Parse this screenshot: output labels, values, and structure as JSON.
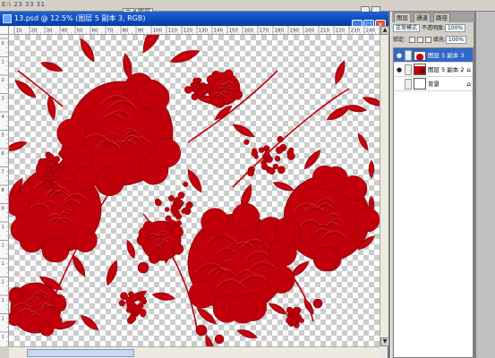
{
  "app": {
    "top_path": "E:\\ 23 33 31",
    "top_tabs": [
      "☰",
      "图层",
      "☰"
    ]
  },
  "document": {
    "title": "13.psd @ 12.5% (图层 5 副本 3, RGB)",
    "ruler_h_labels": [
      "10",
      "20",
      "30",
      "40",
      "50",
      "60",
      "70",
      "80",
      "90",
      "100",
      "110",
      "120",
      "130",
      "140",
      "150",
      "160",
      "170",
      "180",
      "190",
      "200",
      "210",
      "220",
      "230",
      "240"
    ],
    "ruler_v_labels": [
      "0",
      "10",
      "20",
      "30",
      "40",
      "50",
      "60",
      "70",
      "80",
      "90",
      "100",
      "110",
      "120",
      "130",
      "140",
      "150",
      "160"
    ],
    "artwork_colors": {
      "red": "#c1000b",
      "dark_red": "#7e0008",
      "highlight": "#e53a3a"
    }
  },
  "layers_panel": {
    "tabs": [
      "图层",
      "通道",
      "路径"
    ],
    "blend_mode": "正常模式",
    "opacity_label": "不透明度:",
    "opacity_value": "100%",
    "lock_label": "锁定:",
    "fill_label": "填充:",
    "fill_value": "100%",
    "layers": [
      {
        "name": "图层 5 副本 3",
        "selected": true,
        "visible": true
      },
      {
        "name": "图层 5 副本 2",
        "selected": false,
        "visible": true
      },
      {
        "name": "背景",
        "selected": false,
        "visible": false
      }
    ]
  }
}
